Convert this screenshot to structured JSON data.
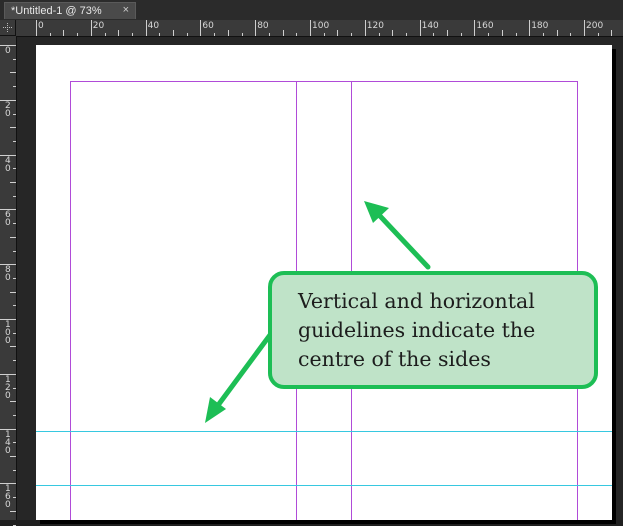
{
  "tab": {
    "title": "*Untitled-1 @ 73%",
    "close_glyph": "×"
  },
  "ruler": {
    "horizontal_labels": [
      "0",
      "20",
      "40",
      "60",
      "80",
      "100",
      "120",
      "140",
      "160",
      "180",
      "200"
    ],
    "vertical_labels": [
      "0",
      "20",
      "40",
      "60",
      "80",
      "100",
      "120",
      "140",
      "160"
    ]
  },
  "callout": {
    "lines": [
      "Vertical and horizontal",
      "guidelines indicate the",
      "centre of the sides"
    ]
  },
  "colors": {
    "margin_guide": "#b04bd8",
    "center_guide": "#37c8e0",
    "callout_fill": "#bfe3c8",
    "callout_border": "#1dbe55",
    "arrow": "#1dbe55"
  }
}
